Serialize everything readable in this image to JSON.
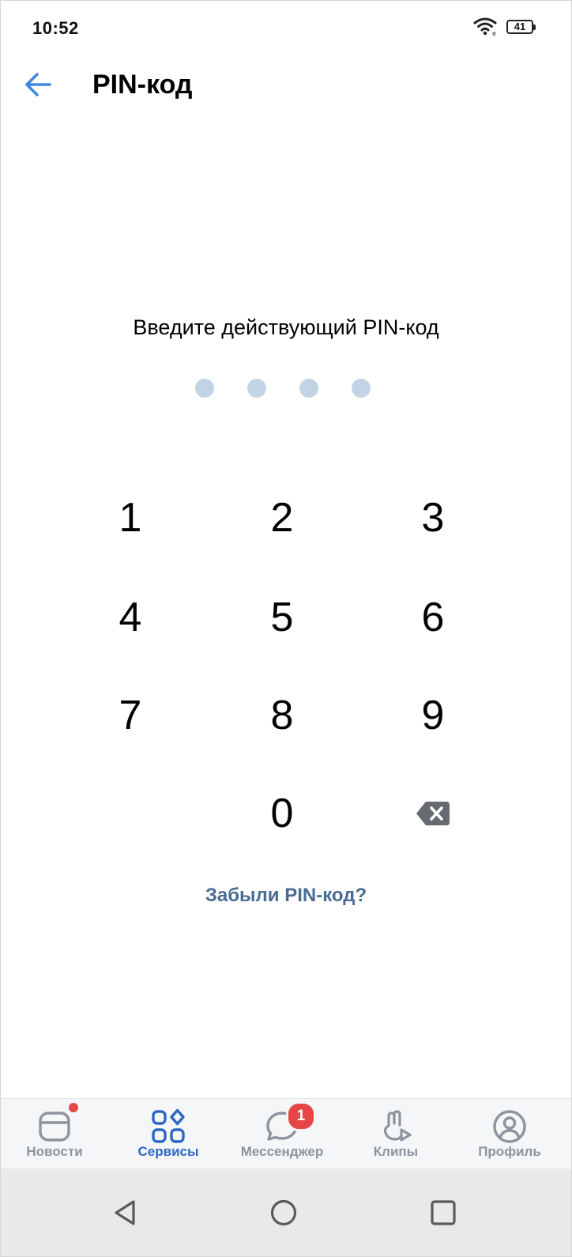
{
  "status_bar": {
    "time": "10:52",
    "battery_level": "41",
    "icons": [
      "wifi-icon",
      "battery-icon"
    ]
  },
  "header": {
    "title": "PIN-код",
    "back_icon": "arrow-left-icon"
  },
  "pin": {
    "prompt": "Введите действующий PIN-код",
    "length": 4,
    "entered": 0,
    "dot_color_empty": "#c3d3e6"
  },
  "keypad": {
    "keys": [
      "1",
      "2",
      "3",
      "4",
      "5",
      "6",
      "7",
      "8",
      "9",
      "0"
    ],
    "backspace_icon": "backspace-icon"
  },
  "forgot_link": "Забыли PIN-код?",
  "tab_bar": {
    "tabs": [
      {
        "label": "Новости",
        "icon": "news-icon",
        "active": false,
        "badge_dot": true
      },
      {
        "label": "Сервисы",
        "icon": "services-icon",
        "active": true
      },
      {
        "label": "Мессенджер",
        "icon": "messenger-icon",
        "active": false,
        "badge_count": "1"
      },
      {
        "label": "Клипы",
        "icon": "clips-icon",
        "active": false
      },
      {
        "label": "Профиль",
        "icon": "profile-icon",
        "active": false
      }
    ]
  },
  "android_nav": [
    "back-triangle-icon",
    "home-circle-icon",
    "recents-square-icon"
  ],
  "colors": {
    "accent": "#2c66c7",
    "back_arrow": "#3f8ae0",
    "link": "#4a6b92",
    "badge": "#e64646",
    "tab_inactive": "#8d949e"
  }
}
